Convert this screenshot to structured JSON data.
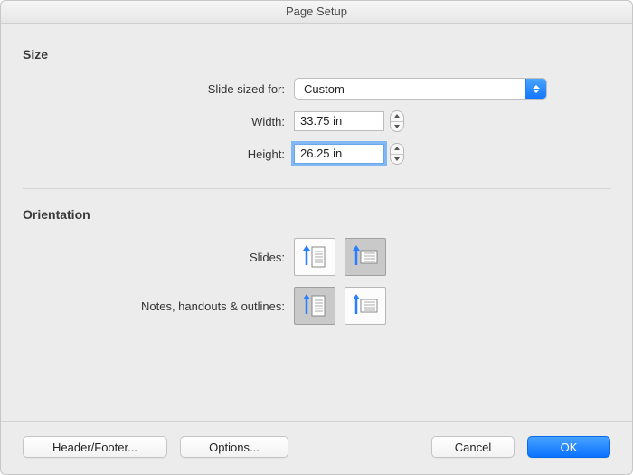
{
  "title": "Page Setup",
  "size": {
    "section_label": "Size",
    "sized_for_label": "Slide sized for:",
    "sized_for_value": "Custom",
    "width_label": "Width:",
    "width_value": "33.75 in",
    "height_label": "Height:",
    "height_value": "26.25 in"
  },
  "orientation": {
    "section_label": "Orientation",
    "slides_label": "Slides:",
    "notes_label": "Notes, handouts & outlines:",
    "slides_selected": "landscape",
    "notes_selected": "portrait"
  },
  "buttons": {
    "header_footer": "Header/Footer...",
    "options": "Options...",
    "cancel": "Cancel",
    "ok": "OK"
  }
}
